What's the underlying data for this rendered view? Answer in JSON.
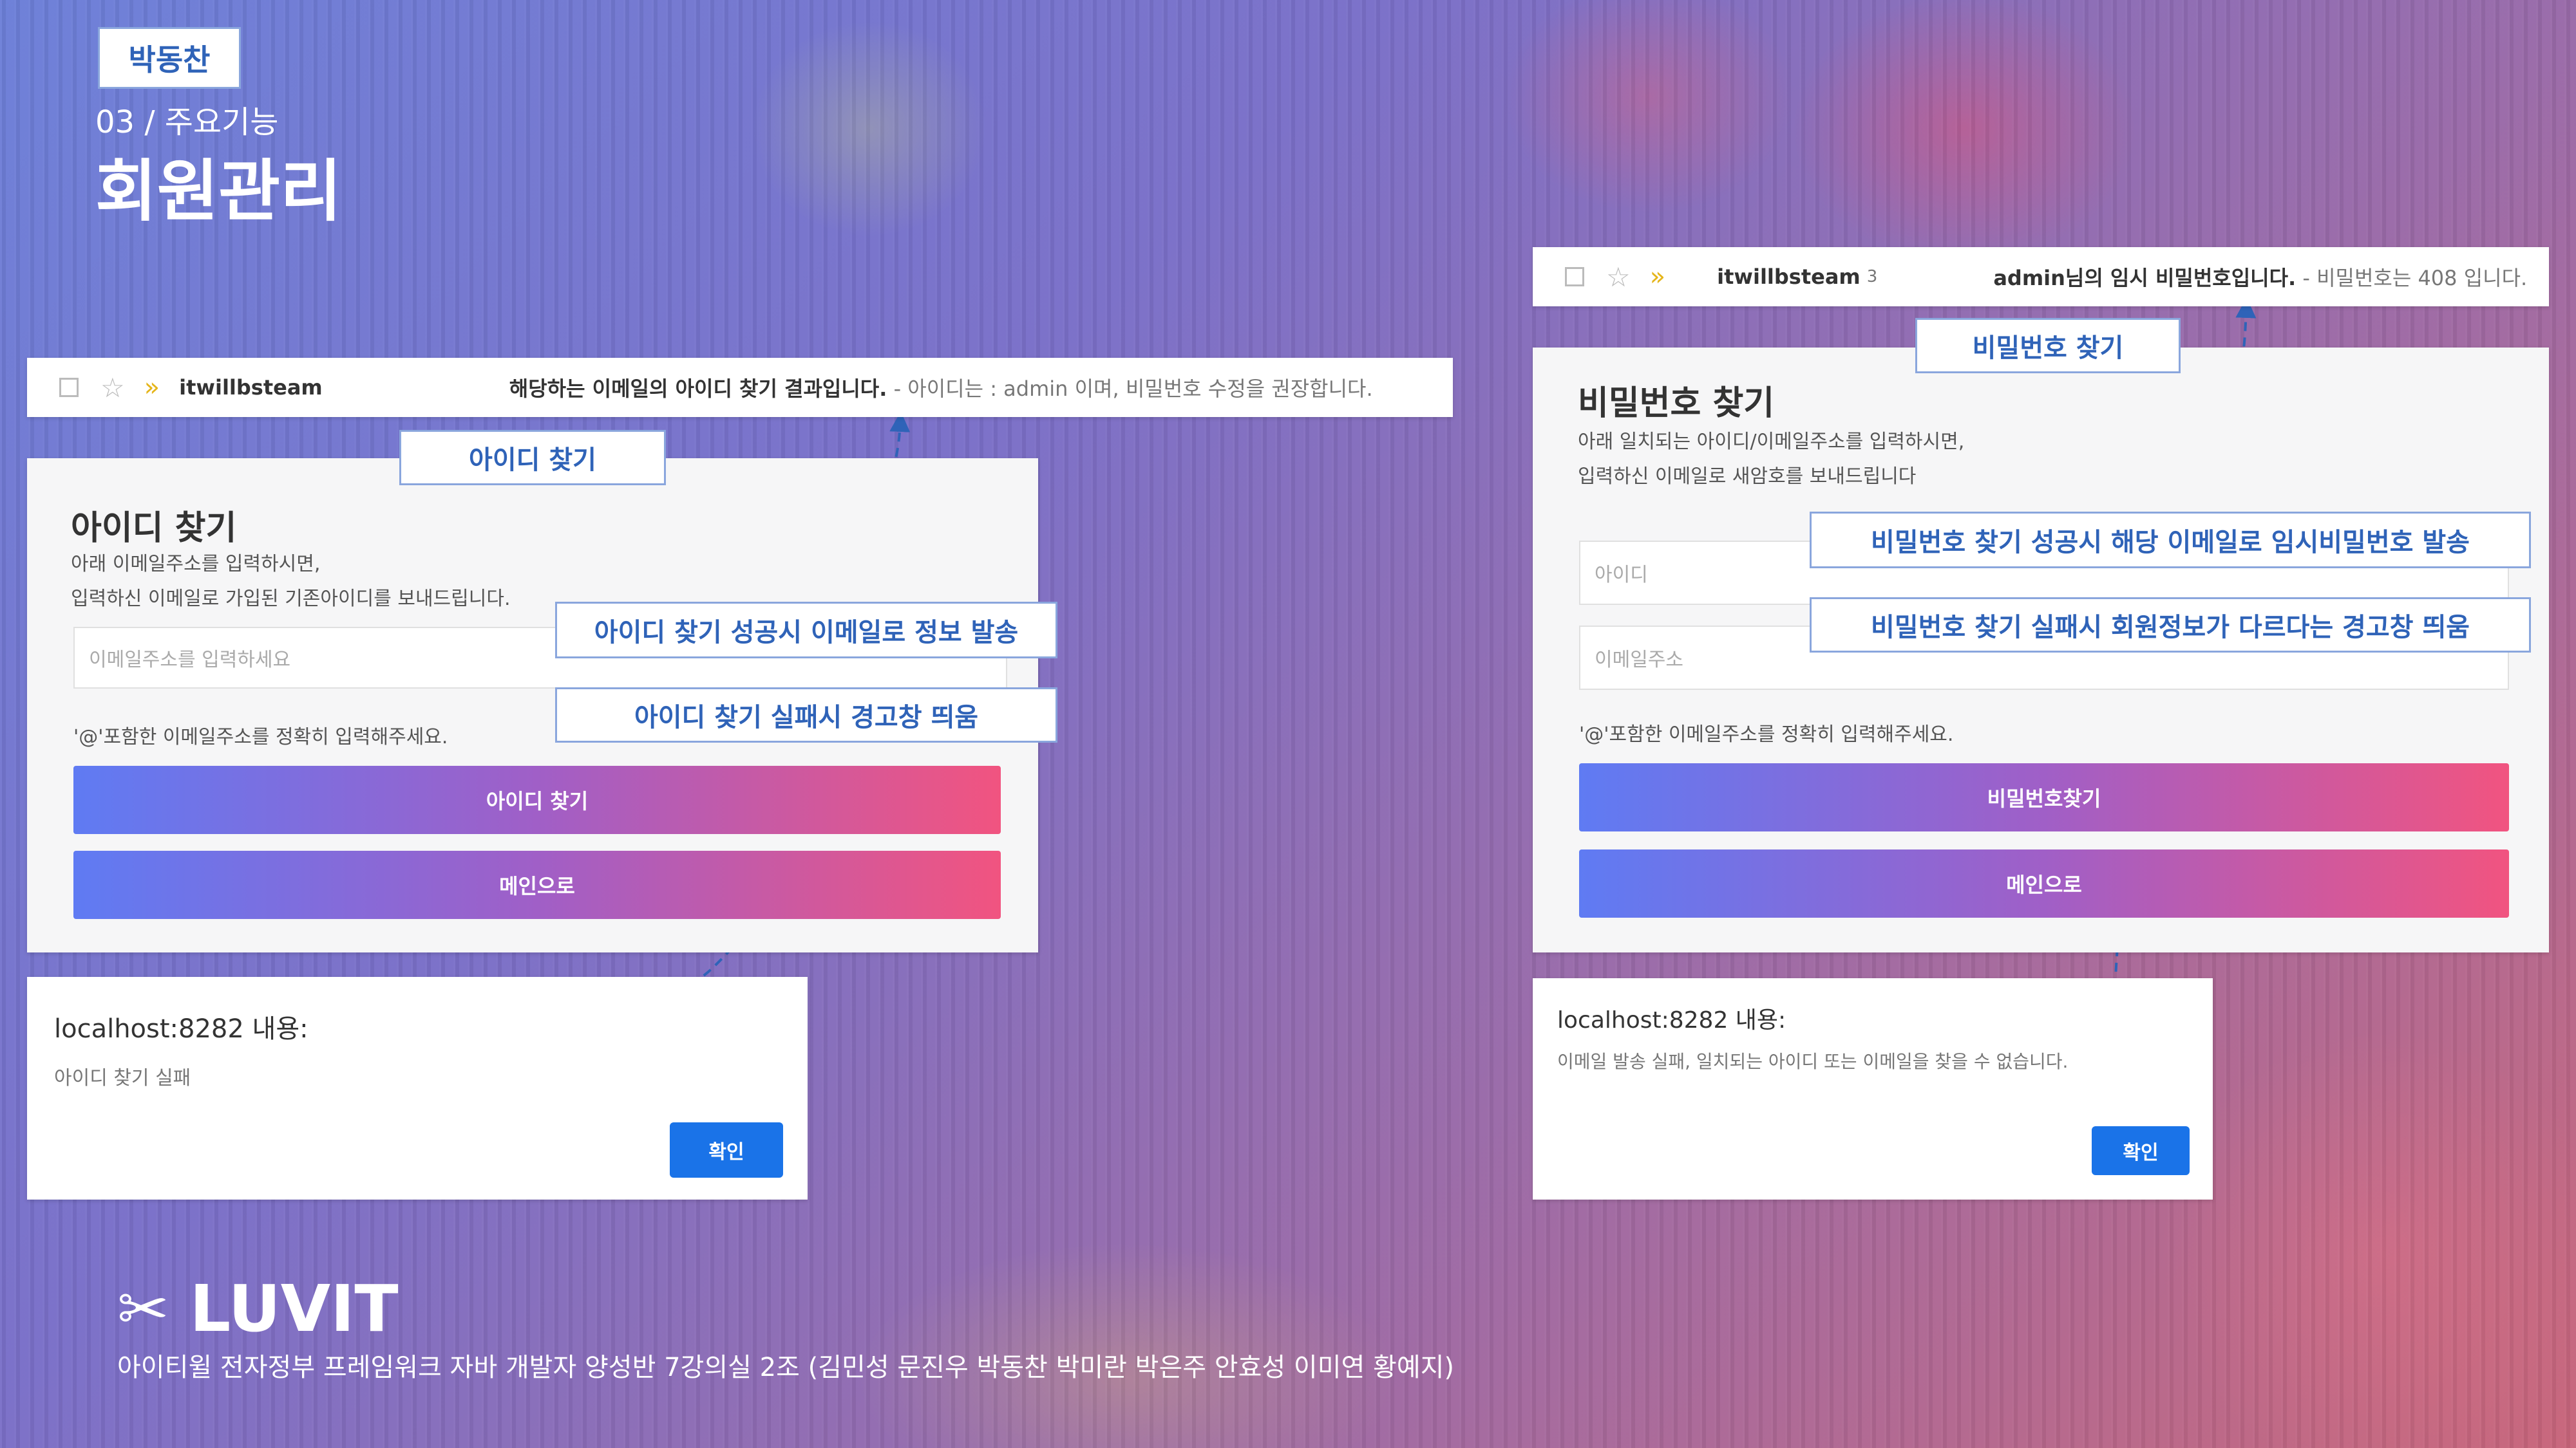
{
  "header": {
    "author_tag": "박동찬",
    "section": "03 / 주요기능",
    "title": "회원관리"
  },
  "left": {
    "mail_row": {
      "sender": "itwillbsteam",
      "subject": "해당하는 이메일의 아이디 찾기 결과입니다.",
      "snippet": " - 아이디는 : admin 이며, 비밀번호 수정을 권장합니다."
    },
    "callout_title": "아이디 찾기",
    "form": {
      "heading": "아이디 찾기",
      "desc_line1": "아래 이메일주소를 입력하시면,",
      "desc_line2": "입력하신 이메일로 가입된 기존아이디를 보내드립니다.",
      "email_placeholder": "이메일주소를 입력하세요",
      "hint": "'@'포함한 이메일주소를 정확히 입력해주세요.",
      "submit_label": "아이디 찾기",
      "main_label": "메인으로"
    },
    "callout_success": "아이디 찾기 성공시 이메일로 정보 발송",
    "callout_fail": "아이디 찾기 실패시 경고창 띄움",
    "dialog": {
      "title": "localhost:8282 내용:",
      "message": "아이디 찾기 실패",
      "ok_label": "확인"
    }
  },
  "right": {
    "mail_row": {
      "sender": "itwillbsteam",
      "count": "3",
      "subject": "admin님의 임시 비밀번호입니다.",
      "snippet": " - 비밀번호는 408 입니다."
    },
    "callout_title": "비밀번호 찾기",
    "form": {
      "heading": "비밀번호 찾기",
      "desc_line1": "아래 일치되는 아이디/이메일주소를 입력하시면,",
      "desc_line2": "입력하신 이메일로 새암호를 보내드립니다",
      "id_placeholder": "아이디",
      "email_placeholder": "이메일주소",
      "hint": "'@'포함한 이메일주소를 정확히 입력해주세요.",
      "submit_label": "비밀번호찾기",
      "main_label": "메인으로"
    },
    "callout_success": "비밀번호 찾기 성공시 해당 이메일로 임시비밀번호 발송",
    "callout_fail": "비밀번호 찾기 실패시 회원정보가 다르다는 경고창 띄움",
    "dialog": {
      "title": "localhost:8282 내용:",
      "message": "이메일 발송 실패, 일치되는 아이디 또는 이메일을 찾을 수 없습니다.",
      "ok_label": "확인"
    }
  },
  "footer": {
    "brand": "LUVIT",
    "brand_icon": "crossed-utensils-icon",
    "text": "아이티윌 전자정부 프레임워크 자바 개발자 양성반 7강의실 2조 (김민성 문진우 박동찬 박미란 박은주 안효성 이미연 황예지)"
  },
  "colors": {
    "accent_blue": "#2f63b8",
    "callout_border": "#8aa6dd",
    "button_gradient_start": "#5f7bf3",
    "button_gradient_end": "#f15480",
    "ok_button": "#1a73e8"
  }
}
